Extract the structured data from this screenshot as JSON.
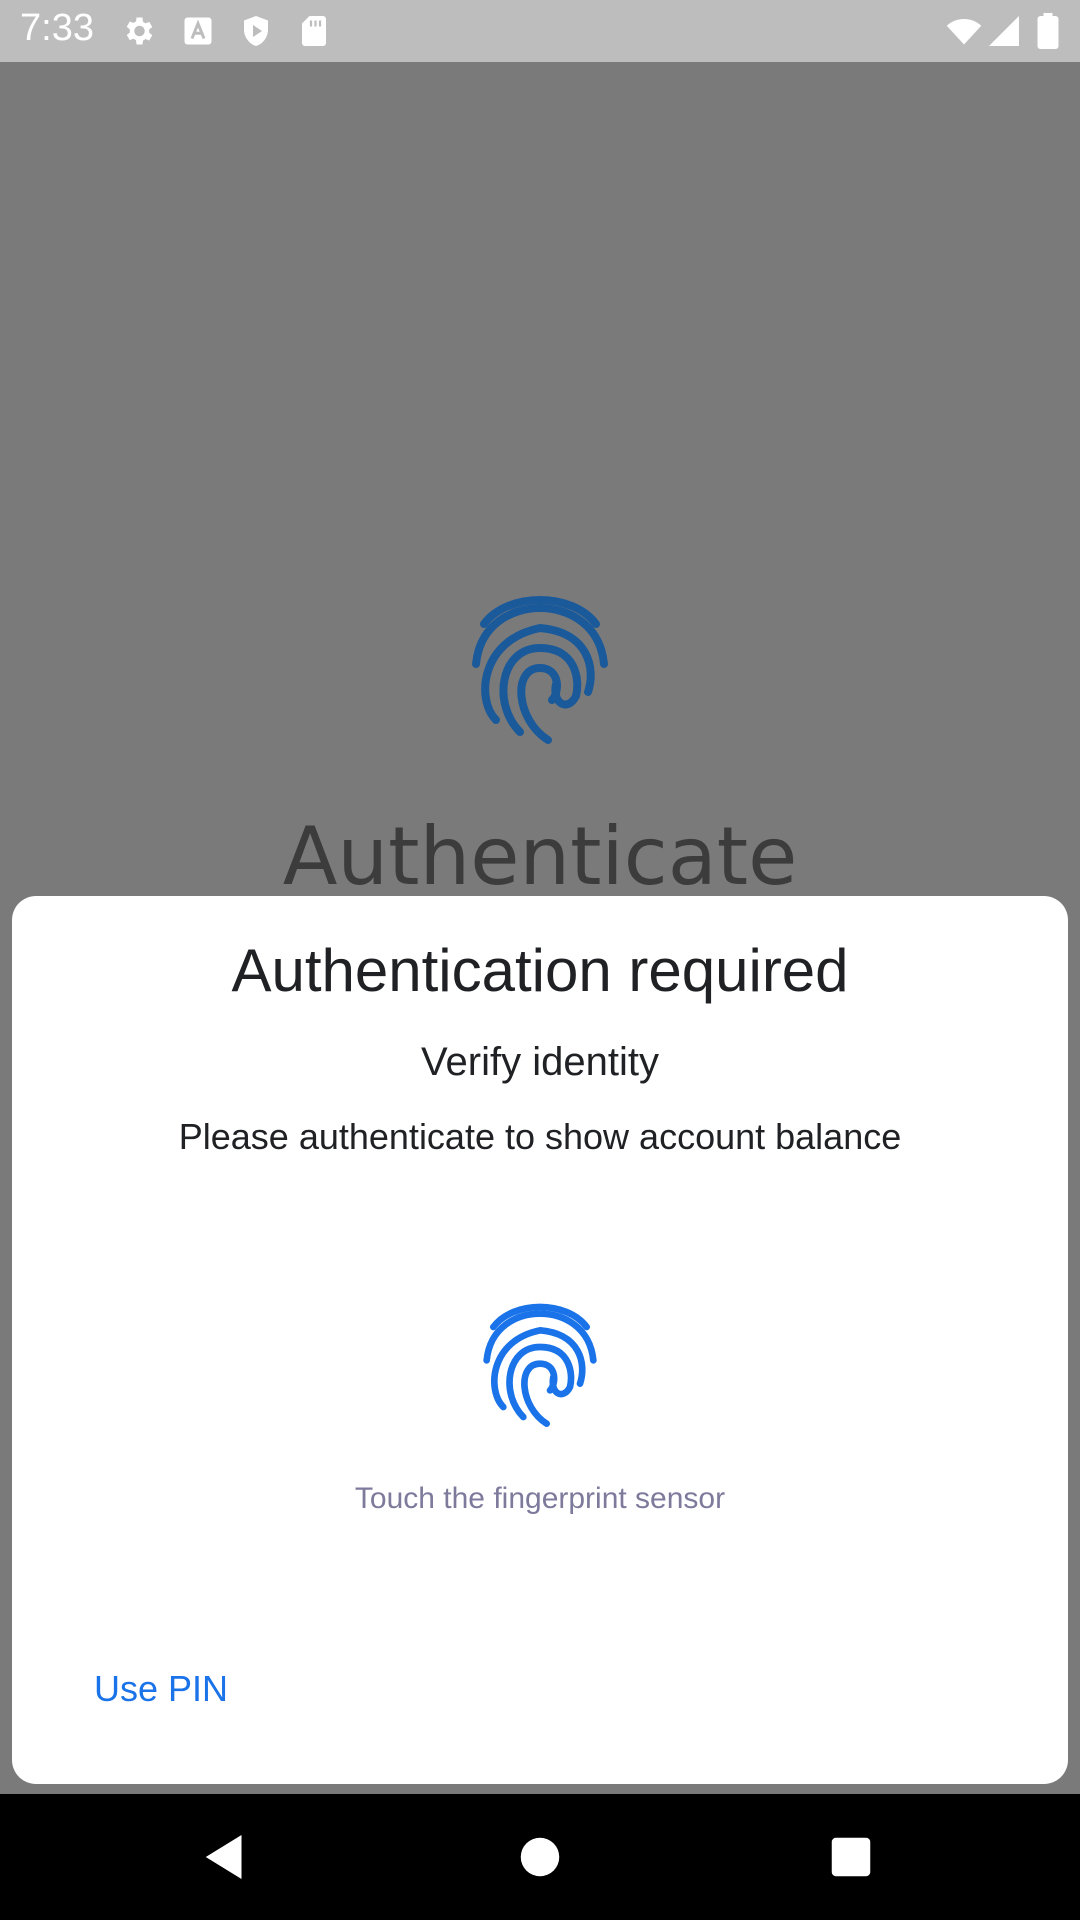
{
  "status_bar": {
    "time": "7:33",
    "icons": [
      "settings-icon",
      "keyboard-a-icon",
      "play-protect-icon",
      "sd-card-icon",
      "wifi-icon",
      "signal-icon",
      "battery-icon"
    ]
  },
  "background": {
    "title": "Authenticate",
    "fingerprint_color": "#1a5a9a"
  },
  "dialog": {
    "title": "Authentication required",
    "subtitle": "Verify identity",
    "description": "Please authenticate to show account balance",
    "hint": "Touch the fingerprint sensor",
    "use_pin_label": "Use PIN",
    "accent_color": "#1a73e8"
  },
  "nav_bar": {
    "buttons": [
      "back-icon",
      "home-icon",
      "recents-icon"
    ]
  }
}
